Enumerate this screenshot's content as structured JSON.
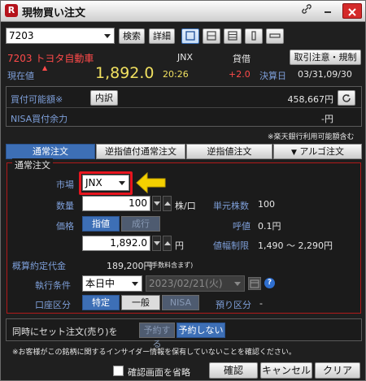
{
  "window": {
    "title": "現物買い注文"
  },
  "toolbar": {
    "symbol_value": "7203",
    "search_label": "検索",
    "detail_label": "詳細"
  },
  "stock": {
    "code_name": "7203 トヨタ自動車",
    "market": "JNX",
    "margin_type": "貸借",
    "rules_button": "取引注意・規制",
    "current_label": "現在値",
    "up_mark": "▲",
    "price": "1,892.0",
    "time": "20:26",
    "change": "+2.0",
    "settle_label": "決算日",
    "settle_dates": "03/31,09/30"
  },
  "funds": {
    "buying_power_label": "買付可能額※",
    "breakdown_button": "内訳",
    "buying_power_value": "458,667円",
    "nisa_label": "NISA買付余力",
    "nisa_value": "-円",
    "note": "※楽天銀行利用可能額含む"
  },
  "tabs": [
    {
      "label": "通常注文"
    },
    {
      "label": "逆指値付通常注文"
    },
    {
      "label": "逆指値注文"
    },
    {
      "label": "アルゴ注文"
    }
  ],
  "order": {
    "section_title": "通常注文",
    "market_label": "市場",
    "market_value": "JNX",
    "qty_label": "数量",
    "qty_value": "100",
    "qty_unit": "株/口",
    "unit_label": "単元株数",
    "unit_value": "100",
    "price_label": "価格",
    "limit_label": "指値",
    "market_order_label": "成行",
    "tick_label": "呼値",
    "tick_value": "0.1円",
    "price_value": "1,892.0",
    "yen": "円",
    "range_label": "値幅制限",
    "range_value": "1,490 ～ 2,290円",
    "est_label": "概算約定代金",
    "est_value": "189,200円",
    "est_note": "(手数料含まず)",
    "cond_label": "執行条件",
    "cond_value": "本日中",
    "date_value": "2023/02/21(火)",
    "account_label": "口座区分",
    "acct_specific": "特定",
    "acct_general": "一般",
    "acct_nisa": "NISA",
    "custody_label": "預り区分",
    "custody_value": "-"
  },
  "set_order": {
    "label": "同時にセット注文(売り)を",
    "yes": "予約する",
    "no": "予約しない"
  },
  "insider_note": "※お客様がこの銘柄に関するインサイダー情報を保有していないことを確認ください。",
  "footer": {
    "skip_confirm_label": "確認画面を省略",
    "confirm_button": "確認",
    "cancel_button": "キャンセル",
    "clear_button": "クリア"
  },
  "colors": {
    "accent_blue": "#3d6fb6",
    "highlight_red": "#e8151f",
    "arrow_yellow": "#f4d000",
    "price_yellow": "#f0e060",
    "label_blue": "#7e9fd9"
  }
}
